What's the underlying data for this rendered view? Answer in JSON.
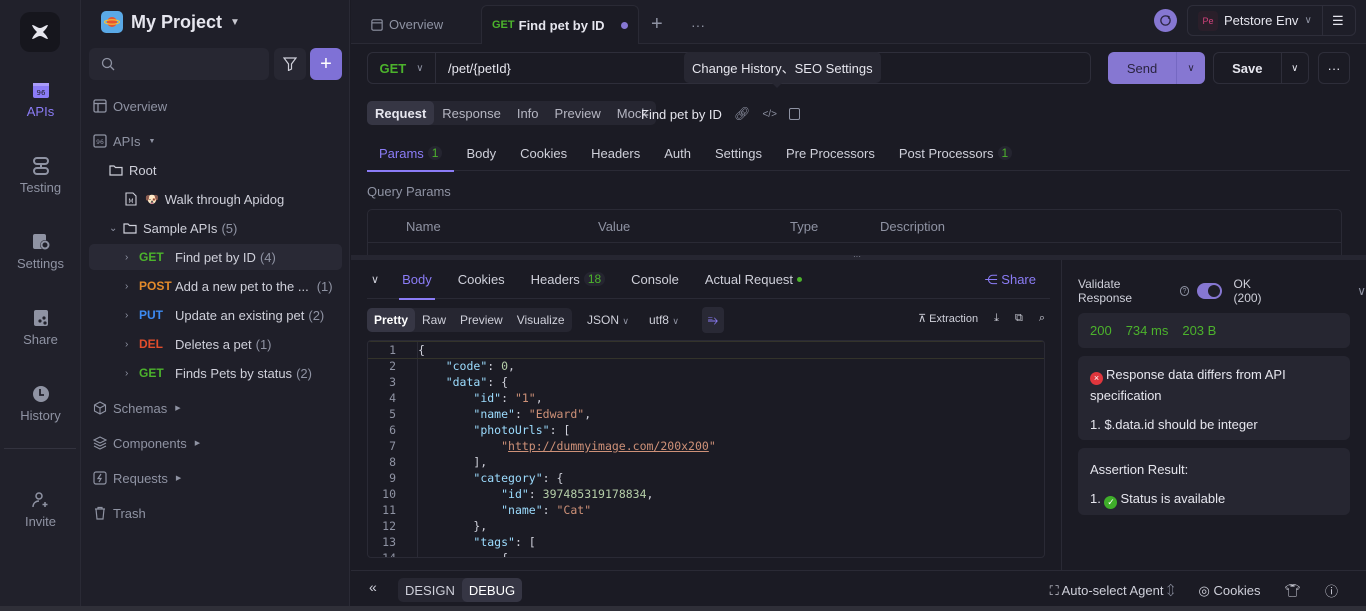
{
  "rail": {
    "items": [
      {
        "label": "APIs",
        "icon": "apis-icon",
        "active": true
      },
      {
        "label": "Testing",
        "icon": "testing-icon"
      },
      {
        "label": "Settings",
        "icon": "settings-icon"
      },
      {
        "label": "Share",
        "icon": "share-icon"
      },
      {
        "label": "History",
        "icon": "history-icon"
      },
      {
        "label": "Invite",
        "icon": "invite-icon"
      }
    ]
  },
  "sidebar": {
    "project_name": "My Project",
    "search_placeholder": "",
    "overview": "Overview",
    "apis": "APIs",
    "root": "Root",
    "walkthrough": "Walk through Apidog",
    "sample_folder": "Sample APIs",
    "sample_count": "(5)",
    "endpoints": [
      {
        "method": "GET",
        "name": "Find pet by ID",
        "count": "(4)"
      },
      {
        "method": "POST",
        "name": "Add a new pet to the ...",
        "count": "(1)"
      },
      {
        "method": "PUT",
        "name": "Update an existing pet",
        "count": "(2)"
      },
      {
        "method": "DEL",
        "name": "Deletes a pet",
        "count": "(1)"
      },
      {
        "method": "GET",
        "name": "Finds Pets by status",
        "count": "(2)"
      }
    ],
    "schemas": "Schemas",
    "components": "Components",
    "requests": "Requests",
    "trash": "Trash"
  },
  "tabs": {
    "overview": "Overview",
    "active_method": "GET",
    "active_title": "Find pet by ID"
  },
  "header": {
    "env_badge": "Pe",
    "env_name": "Petstore Env"
  },
  "request": {
    "method": "GET",
    "path": "/pet/{petId}",
    "tooltip": "Change History、SEO Settings",
    "send": "Send",
    "save": "Save",
    "view_tabs": [
      "Request",
      "Response",
      "Info",
      "Preview",
      "Mock"
    ],
    "endpoint_name": "Find pet by ID",
    "subtabs": [
      {
        "label": "Params",
        "badge": "1"
      },
      {
        "label": "Body"
      },
      {
        "label": "Cookies"
      },
      {
        "label": "Headers"
      },
      {
        "label": "Auth"
      },
      {
        "label": "Settings"
      },
      {
        "label": "Pre Processors"
      },
      {
        "label": "Post Processors",
        "badge": "1"
      }
    ],
    "query_params_label": "Query Params",
    "columns": [
      "Name",
      "Value",
      "Type",
      "Description"
    ]
  },
  "response": {
    "tabs": [
      {
        "label": "Body"
      },
      {
        "label": "Cookies"
      },
      {
        "label": "Headers",
        "badge": "18"
      },
      {
        "label": "Console"
      },
      {
        "label": "Actual Request"
      }
    ],
    "share": "Share",
    "formats": [
      "Pretty",
      "Raw",
      "Preview",
      "Visualize"
    ],
    "lang": "JSON",
    "encoding": "utf8",
    "extraction": "Extraction",
    "code_lines": [
      "{",
      "    \"code\": 0,",
      "    \"data\": {",
      "        \"id\": \"1\",",
      "        \"name\": \"Edward\",",
      "        \"photoUrls\": [",
      "            \"http://dummyimage.com/200x200\"",
      "        ],",
      "        \"category\": {",
      "            \"id\": 397485319178834,",
      "            \"name\": \"Cat\"",
      "        },",
      "        \"tags\": [",
      "            {"
    ]
  },
  "validation": {
    "label": "Validate Response",
    "enabled": true,
    "status_select": "OK (200)",
    "status_code": "200",
    "time": "734 ms",
    "size": "203 B",
    "error_title": "Response data differs from API specification",
    "error_item": "1. $.data.id should be integer",
    "assertion_title": "Assertion Result:",
    "assertion_prefix": "1.",
    "assertion_item": "Status is available"
  },
  "bottom": {
    "design": "DESIGN",
    "debug": "DEBUG",
    "agent": "Auto-select Agent",
    "cookies": "Cookies"
  }
}
